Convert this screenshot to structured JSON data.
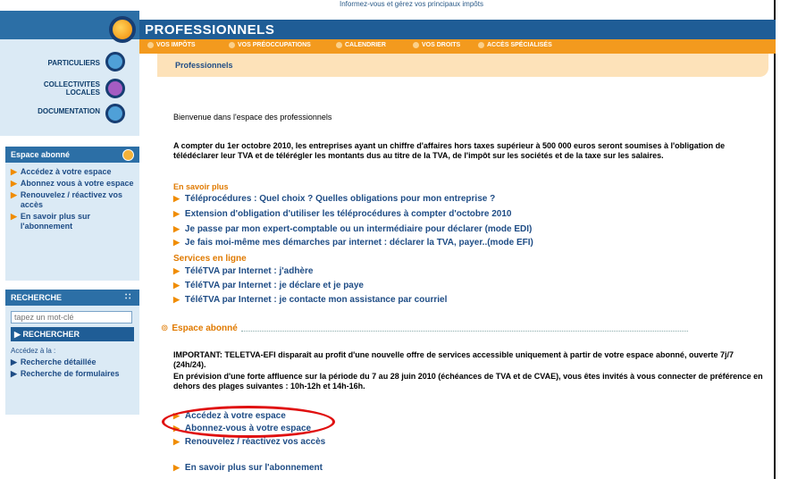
{
  "header": {
    "tagline": "Informez-vous et gérez vos principaux impôts",
    "title": "PROFESSIONNELS",
    "menu": [
      "VOS IMPÔTS",
      "VOS PRÉOCCUPATIONS",
      "CALENDRIER",
      "VOS DROITS",
      "ACCÈS SPÉCIALISÉS"
    ],
    "breadcrumb": "Professionnels"
  },
  "leftnav": {
    "items": [
      "PARTICULIERS",
      "COLLECTIVITES LOCALES",
      "DOCUMENTATION"
    ]
  },
  "espace_abonne_box": {
    "title": "Espace abonné",
    "links": [
      "Accédez à votre espace",
      "Abonnez vous à votre espace",
      "Renouvelez / réactivez vos accès",
      "En savoir plus sur l'abonnement"
    ]
  },
  "search_box": {
    "title": "RECHERCHE",
    "placeholder": "tapez un mot-clé",
    "button": "RECHERCHER",
    "access_label": "Accédez à la :",
    "links": [
      "Recherche détaillée",
      "Recherche de formulaires"
    ]
  },
  "main": {
    "welcome": "Bienvenue dans l'espace des professionnels",
    "intro": "A compter du 1er octobre 2010, les entreprises ayant un chiffre d'affaires hors taxes supérieur à 500 000 euros seront soumises à l'obligation de télédéclarer leur TVA et de télérégler les montants dus au titre de la TVA, de l'impôt sur les sociétés et de la taxe sur les salaires.",
    "en_savoir_plus_title": "En savoir plus",
    "en_savoir_plus_links": [
      "Téléprocédures : Quel choix ? Quelles obligations pour mon entreprise ?",
      "Extension d'obligation d'utiliser les téléprocédures à compter d'octobre 2010",
      "Je passe par mon expert-comptable ou un intermédiaire pour déclarer (mode EDI)",
      "Je fais moi-même mes démarches par internet : déclarer la TVA, payer..(mode EFI)"
    ],
    "services_title": "Services en ligne",
    "services_links": [
      "TéléTVA par Internet : j'adhère",
      "TéléTVA par Internet : je déclare et je paye",
      "TéléTVA par Internet : je contacte mon assistance par courriel"
    ],
    "espace_title": "Espace abonné",
    "important": "IMPORTANT: TELETVA-EFI disparaît au profit d'une nouvelle offre de services accessible uniquement à partir de votre espace abonné, ouverte 7j/7 (24h/24).",
    "affluence": "En prévision d'une forte affluence sur la période du 7 au 28 juin 2010 (échéances de TVA et de CVAE), vous êtes invités à vous connecter de préférence en dehors des plages suivantes : 10h-12h et 14h-16h.",
    "espace_links": [
      "Accédez à votre espace",
      "Abonnez-vous à votre espace",
      "Renouvelez / réactivez vos accès"
    ],
    "last_link": "En savoir plus sur l'abonnement"
  },
  "colors": {
    "brand_blue": "#1f5d96",
    "orange": "#f39a1e",
    "highlight_ring": "#e01010"
  }
}
